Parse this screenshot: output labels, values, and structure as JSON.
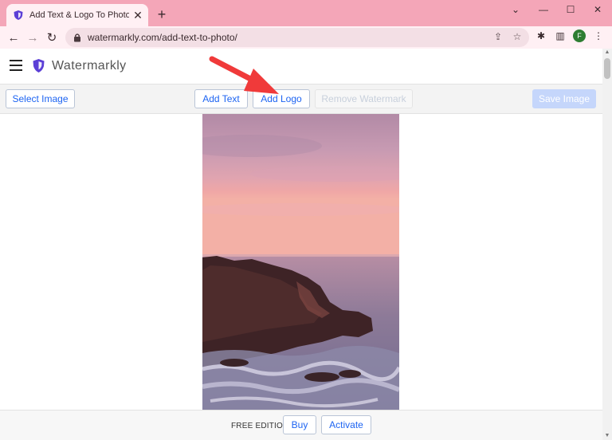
{
  "browser": {
    "tab_title": "Add Text & Logo To Photo Online",
    "tab_close": "✕",
    "new_tab": "+",
    "url": "watermarkly.com/add-text-to-photo/",
    "profile_initial": "F",
    "window_controls": {
      "minimize": "⌄",
      "restore": "—",
      "maximize": "☐",
      "close": "✕"
    }
  },
  "app": {
    "brand_name": "Watermarkly",
    "brand_color": "#5b3fd6",
    "accent_color": "#1d64f2"
  },
  "actionbar": {
    "select_image": "Select Image",
    "add_text": "Add Text",
    "add_logo": "Add Logo",
    "remove_watermark": "Remove Watermark",
    "save_image": "Save Image"
  },
  "footer": {
    "edition": "FREE EDITION",
    "buy": "Buy",
    "activate": "Activate"
  },
  "icons": {
    "back": "←",
    "forward": "→",
    "reload": "↻",
    "share": "⇪",
    "star": "☆",
    "extensions": "✱",
    "sidepanel": "▥",
    "menu": "⋮",
    "scroll_up": "▲",
    "scroll_down": "▼"
  }
}
